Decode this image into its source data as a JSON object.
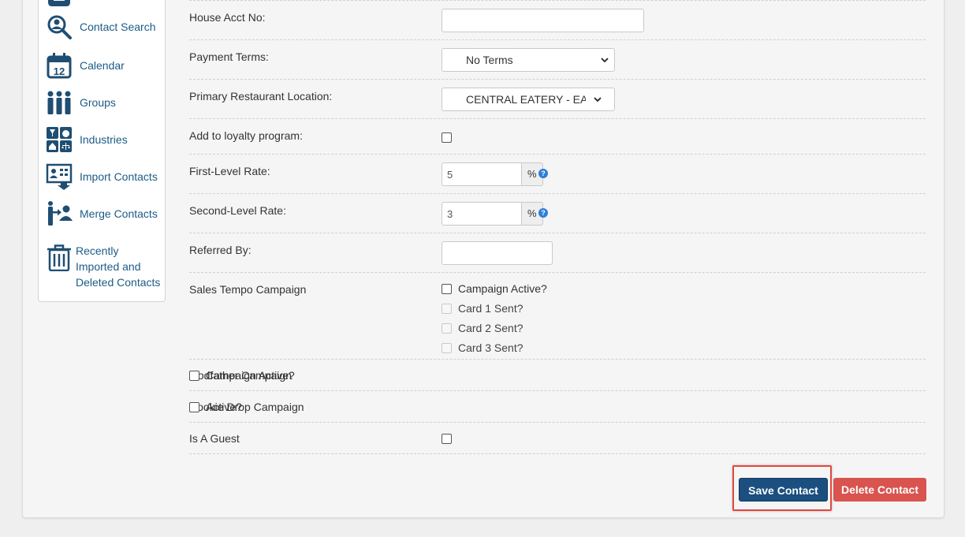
{
  "sidebar": {
    "items": [
      {
        "label": "Contact Search",
        "icon": "magnifier-person-icon"
      },
      {
        "label": "Calendar",
        "icon": "calendar-icon",
        "icon_text": "12"
      },
      {
        "label": "Groups",
        "icon": "group-people-icon"
      },
      {
        "label": "Industries",
        "icon": "industries-icon"
      },
      {
        "label": "Import Contacts",
        "icon": "import-contacts-icon"
      },
      {
        "label": "Merge Contacts",
        "icon": "merge-contacts-icon"
      },
      {
        "label_lines": [
          "Recently",
          "Imported and",
          "Deleted Contacts"
        ],
        "icon": "trash-icon"
      }
    ]
  },
  "form": {
    "house_acct": {
      "label": "House Acct No:",
      "value": ""
    },
    "payment_terms": {
      "label": "Payment Terms:",
      "selected": "No Terms"
    },
    "primary_location": {
      "label": "Primary Restaurant Location:",
      "selected": "CENTRAL EATERY - EAST"
    },
    "loyalty": {
      "label": "Add to loyalty program:",
      "checked": false
    },
    "first_level_rate": {
      "label": "First-Level Rate:",
      "value": "5",
      "unit": "%"
    },
    "second_level_rate": {
      "label": "Second-Level Rate:",
      "value": "3",
      "unit": "%"
    },
    "referred_by": {
      "label": "Referred By:",
      "value": ""
    },
    "sales_tempo": {
      "label": "Sales Tempo Campaign",
      "options": [
        "Campaign Active?",
        "Card 1 Sent?",
        "Card 2 Sent?",
        "Card 3 Sent?"
      ]
    },
    "godfather": {
      "label": "Godfather Campaign",
      "option": "Campaign Active?"
    },
    "cookie_drop": {
      "label": "Cookie Drop Campaign",
      "option": "Active?"
    },
    "guest": {
      "label": "Is A Guest"
    }
  },
  "actions": {
    "save_label": "Save Contact",
    "delete_label": "Delete Contact"
  },
  "colors": {
    "link": "#1c5c86",
    "save": "#1a4f7f",
    "delete": "#d9534f",
    "highlight": "#e5463d"
  }
}
